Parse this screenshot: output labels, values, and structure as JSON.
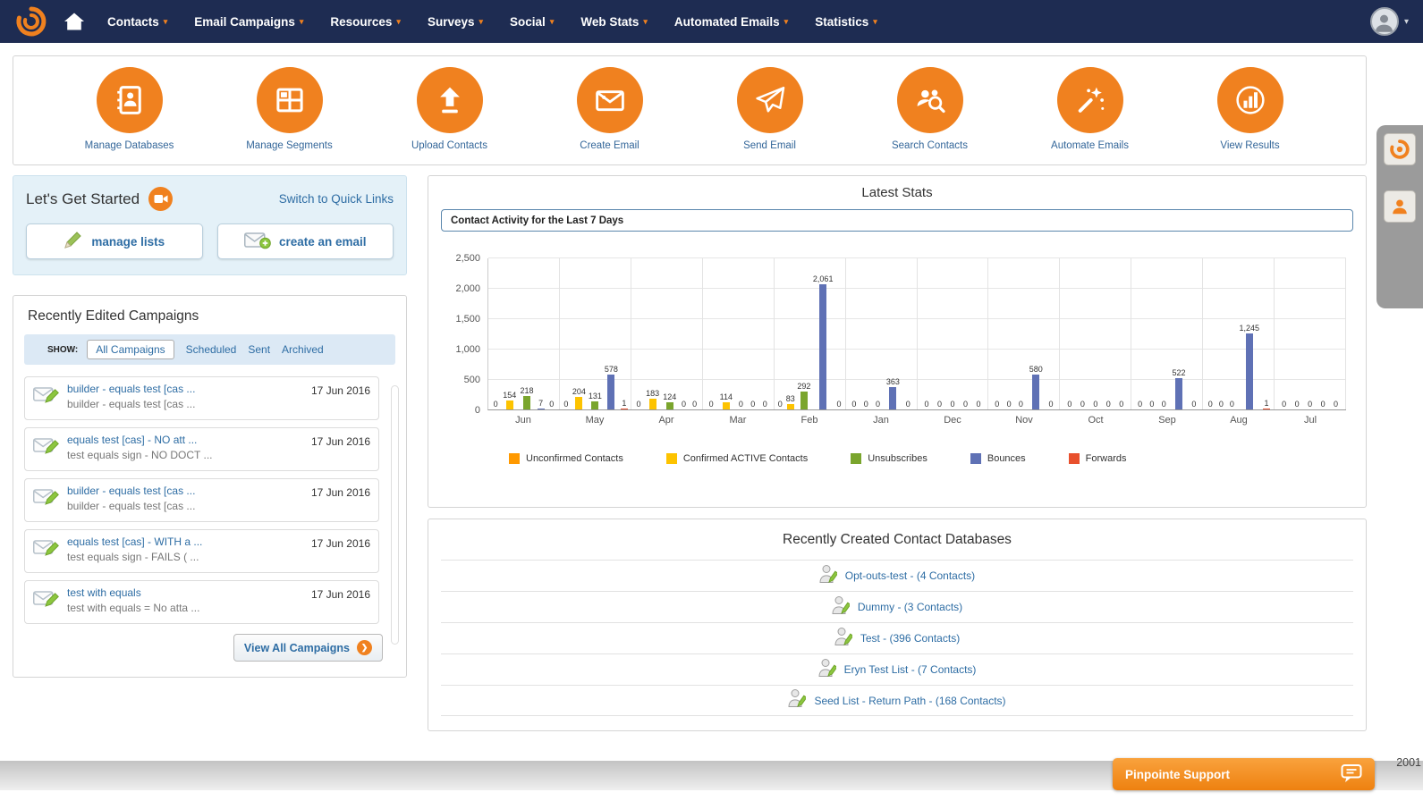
{
  "colors": {
    "accent": "#f0811f",
    "link": "#2e6da4",
    "navbar": "#1e2c52"
  },
  "navbar": {
    "items": [
      {
        "label": "Contacts"
      },
      {
        "label": "Email Campaigns"
      },
      {
        "label": "Resources"
      },
      {
        "label": "Surveys"
      },
      {
        "label": "Social"
      },
      {
        "label": "Web Stats"
      },
      {
        "label": "Automated Emails"
      },
      {
        "label": "Statistics"
      }
    ]
  },
  "quick_actions": [
    {
      "label": "Manage Databases",
      "icon": "address-book-icon"
    },
    {
      "label": "Manage Segments",
      "icon": "segments-grid-icon"
    },
    {
      "label": "Upload Contacts",
      "icon": "upload-arrow-icon"
    },
    {
      "label": "Create Email",
      "icon": "email-image-icon"
    },
    {
      "label": "Send Email",
      "icon": "paper-plane-icon"
    },
    {
      "label": "Search Contacts",
      "icon": "search-contacts-icon"
    },
    {
      "label": "Automate Emails",
      "icon": "magic-wand-icon"
    },
    {
      "label": "View Results",
      "icon": "bar-chart-icon"
    }
  ],
  "get_started": {
    "title": "Let's Get Started",
    "switch_link": "Switch to Quick Links",
    "buttons": [
      {
        "label": "manage lists"
      },
      {
        "label": "create an email"
      }
    ]
  },
  "campaigns": {
    "title": "Recently Edited Campaigns",
    "show_label": "SHOW:",
    "filters": [
      "All Campaigns",
      "Scheduled",
      "Sent",
      "Archived"
    ],
    "active_filter": "All Campaigns",
    "view_all_label": "View All Campaigns",
    "items": [
      {
        "title": "builder - equals test [cas ...",
        "subtitle": "builder - equals test [cas ...",
        "date": "17 Jun 2016"
      },
      {
        "title": "equals test [cas] - NO att ...",
        "subtitle": "test equals sign - NO DOCT ...",
        "date": "17 Jun 2016"
      },
      {
        "title": "builder - equals test [cas ...",
        "subtitle": "builder - equals test [cas ...",
        "date": "17 Jun 2016"
      },
      {
        "title": "equals test [cas] - WITH a ...",
        "subtitle": "test equals sign - FAILS ( ...",
        "date": "17 Jun 2016"
      },
      {
        "title": "test with equals",
        "subtitle": "test with equals = No atta ...",
        "date": "17 Jun 2016"
      }
    ]
  },
  "stats": {
    "title": "Latest Stats",
    "selector": "Contact Activity for the Last 7 Days"
  },
  "chart_data": {
    "type": "bar",
    "title": "Contact Activity for the Last 7 Days",
    "categories": [
      "Jun",
      "May",
      "Apr",
      "Mar",
      "Feb",
      "Jan",
      "Dec",
      "Nov",
      "Oct",
      "Sep",
      "Aug",
      "Jul"
    ],
    "series": [
      {
        "name": "Unconfirmed Contacts",
        "color": "#ff9900",
        "values": [
          0,
          0,
          0,
          0,
          0,
          0,
          0,
          0,
          0,
          0,
          0,
          0
        ]
      },
      {
        "name": "Confirmed ACTIVE Contacts",
        "color": "#fdc300",
        "values": [
          154,
          204,
          183,
          114,
          83,
          0,
          0,
          0,
          0,
          0,
          0,
          0
        ]
      },
      {
        "name": "Unsubscribes",
        "color": "#7aa52d",
        "values": [
          218,
          131,
          124,
          0,
          292,
          0,
          0,
          0,
          0,
          0,
          0,
          0
        ]
      },
      {
        "name": "Bounces",
        "color": "#5f71b5",
        "values": [
          7,
          578,
          0,
          0,
          2061,
          363,
          0,
          580,
          0,
          522,
          1245,
          0
        ]
      },
      {
        "name": "Forwards",
        "color": "#e8502d",
        "values": [
          0,
          1,
          0,
          0,
          0,
          0,
          0,
          0,
          0,
          0,
          1,
          0
        ]
      }
    ],
    "ylim": [
      0,
      2500
    ],
    "yticks": [
      "0",
      "500",
      "1,000",
      "1,500",
      "2,000",
      "2,500"
    ],
    "grid": true,
    "legend_position": "bottom"
  },
  "databases": {
    "title": "Recently Created Contact Databases",
    "items": [
      {
        "label": "Opt-outs-test - (4 Contacts)"
      },
      {
        "label": "Dummy - (3 Contacts)"
      },
      {
        "label": "Test - (396 Contacts)"
      },
      {
        "label": "Eryn Test List - (7 Contacts)"
      },
      {
        "label": "Seed List - Return Path - (168 Contacts)"
      }
    ]
  },
  "footer": {
    "support_label": "Pinpointe Support",
    "copyright_fragment": "2001"
  }
}
